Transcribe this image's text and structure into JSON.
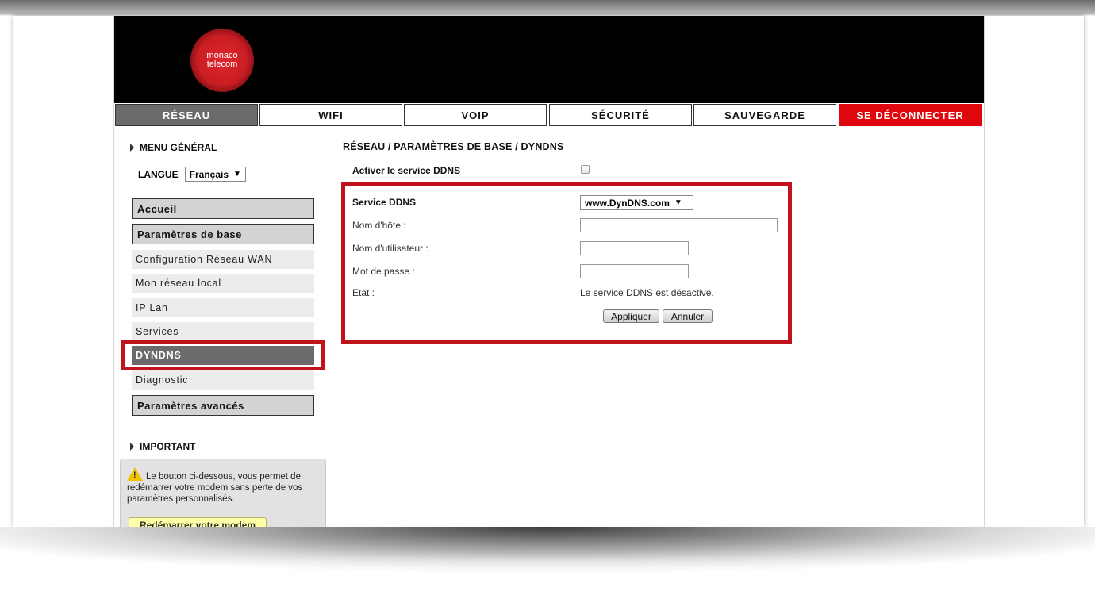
{
  "brand": {
    "logo_line1": "monaco",
    "logo_line2": "telecom"
  },
  "nav": {
    "tabs": [
      {
        "label": "RÉSEAU",
        "state": "active"
      },
      {
        "label": "WIFI",
        "state": "default"
      },
      {
        "label": "VOIP",
        "state": "default"
      },
      {
        "label": "SÉCURITÉ",
        "state": "default"
      },
      {
        "label": "SAUVEGARDE",
        "state": "default"
      },
      {
        "label": "SE DÉCONNECTER",
        "state": "logout"
      }
    ]
  },
  "sidebar": {
    "menu_title": "MENU GÉNÉRAL",
    "langue_label": "LANGUE",
    "langue_value": "Français",
    "items": [
      {
        "label": "Accueil",
        "kind": "main"
      },
      {
        "label": "Paramètres de base",
        "kind": "main"
      },
      {
        "label": "Configuration Réseau WAN",
        "kind": "sub"
      },
      {
        "label": "Mon réseau local",
        "kind": "sub"
      },
      {
        "label": "IP Lan",
        "kind": "sub"
      },
      {
        "label": "Services",
        "kind": "sub"
      },
      {
        "label": "DYNDNS",
        "kind": "sub-active"
      },
      {
        "label": "Diagnostic",
        "kind": "sub"
      },
      {
        "label": "Paramètres avancés",
        "kind": "main"
      }
    ],
    "important_title": "IMPORTANT",
    "important_text": "Le bouton ci-dessous, vous permet de redémarrer votre modem sans perte de vos paramètres personnalisés.",
    "restart_label": "Redémarrer votre modem"
  },
  "main": {
    "breadcrumb": "RÉSEAU / PARAMÈTRES DE BASE / DYNDNS",
    "activate_label": "Activer le service DDNS",
    "activate_checked": false,
    "form": {
      "service_label": "Service DDNS",
      "service_value": "www.DynDNS.com",
      "hostname_label": "Nom d'hôte :",
      "hostname_value": "",
      "username_label": "Nom d'utilisateur :",
      "username_value": "",
      "password_label": "Mot de passe :",
      "password_value": "",
      "status_label": "Etat :",
      "status_value": "Le service DDNS est désactivé.",
      "apply_label": "Appliquer",
      "cancel_label": "Annuler"
    }
  },
  "colors": {
    "accent_red": "#e0060e",
    "highlight_red": "#c1131b",
    "active_gray": "#6b6b6b",
    "header_black": "#000000"
  }
}
